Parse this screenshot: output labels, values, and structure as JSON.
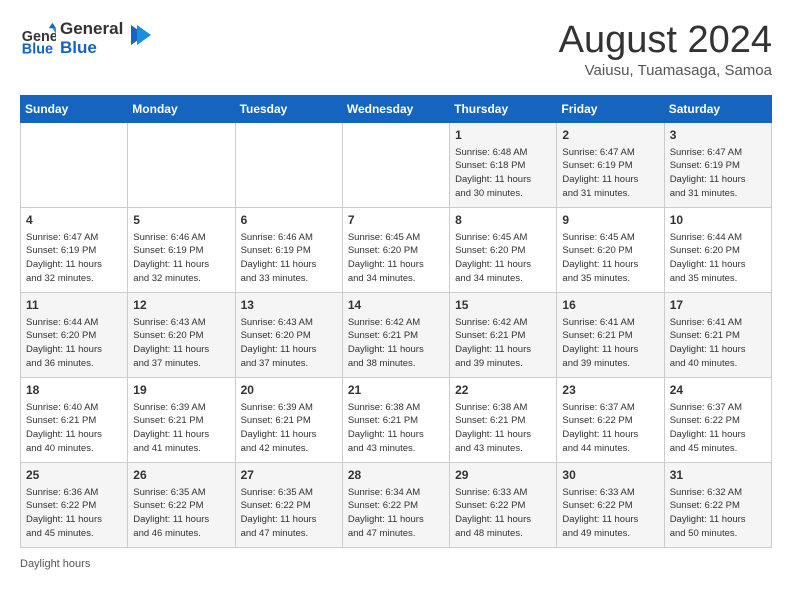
{
  "header": {
    "logo_line1": "General",
    "logo_line2": "Blue",
    "month_year": "August 2024",
    "location": "Vaiusu, Tuamasaga, Samoa"
  },
  "days_of_week": [
    "Sunday",
    "Monday",
    "Tuesday",
    "Wednesday",
    "Thursday",
    "Friday",
    "Saturday"
  ],
  "weeks": [
    [
      {
        "day": "",
        "info": ""
      },
      {
        "day": "",
        "info": ""
      },
      {
        "day": "",
        "info": ""
      },
      {
        "day": "",
        "info": ""
      },
      {
        "day": "1",
        "info": "Sunrise: 6:48 AM\nSunset: 6:18 PM\nDaylight: 11 hours\nand 30 minutes."
      },
      {
        "day": "2",
        "info": "Sunrise: 6:47 AM\nSunset: 6:19 PM\nDaylight: 11 hours\nand 31 minutes."
      },
      {
        "day": "3",
        "info": "Sunrise: 6:47 AM\nSunset: 6:19 PM\nDaylight: 11 hours\nand 31 minutes."
      }
    ],
    [
      {
        "day": "4",
        "info": "Sunrise: 6:47 AM\nSunset: 6:19 PM\nDaylight: 11 hours\nand 32 minutes."
      },
      {
        "day": "5",
        "info": "Sunrise: 6:46 AM\nSunset: 6:19 PM\nDaylight: 11 hours\nand 32 minutes."
      },
      {
        "day": "6",
        "info": "Sunrise: 6:46 AM\nSunset: 6:19 PM\nDaylight: 11 hours\nand 33 minutes."
      },
      {
        "day": "7",
        "info": "Sunrise: 6:45 AM\nSunset: 6:20 PM\nDaylight: 11 hours\nand 34 minutes."
      },
      {
        "day": "8",
        "info": "Sunrise: 6:45 AM\nSunset: 6:20 PM\nDaylight: 11 hours\nand 34 minutes."
      },
      {
        "day": "9",
        "info": "Sunrise: 6:45 AM\nSunset: 6:20 PM\nDaylight: 11 hours\nand 35 minutes."
      },
      {
        "day": "10",
        "info": "Sunrise: 6:44 AM\nSunset: 6:20 PM\nDaylight: 11 hours\nand 35 minutes."
      }
    ],
    [
      {
        "day": "11",
        "info": "Sunrise: 6:44 AM\nSunset: 6:20 PM\nDaylight: 11 hours\nand 36 minutes."
      },
      {
        "day": "12",
        "info": "Sunrise: 6:43 AM\nSunset: 6:20 PM\nDaylight: 11 hours\nand 37 minutes."
      },
      {
        "day": "13",
        "info": "Sunrise: 6:43 AM\nSunset: 6:20 PM\nDaylight: 11 hours\nand 37 minutes."
      },
      {
        "day": "14",
        "info": "Sunrise: 6:42 AM\nSunset: 6:21 PM\nDaylight: 11 hours\nand 38 minutes."
      },
      {
        "day": "15",
        "info": "Sunrise: 6:42 AM\nSunset: 6:21 PM\nDaylight: 11 hours\nand 39 minutes."
      },
      {
        "day": "16",
        "info": "Sunrise: 6:41 AM\nSunset: 6:21 PM\nDaylight: 11 hours\nand 39 minutes."
      },
      {
        "day": "17",
        "info": "Sunrise: 6:41 AM\nSunset: 6:21 PM\nDaylight: 11 hours\nand 40 minutes."
      }
    ],
    [
      {
        "day": "18",
        "info": "Sunrise: 6:40 AM\nSunset: 6:21 PM\nDaylight: 11 hours\nand 40 minutes."
      },
      {
        "day": "19",
        "info": "Sunrise: 6:39 AM\nSunset: 6:21 PM\nDaylight: 11 hours\nand 41 minutes."
      },
      {
        "day": "20",
        "info": "Sunrise: 6:39 AM\nSunset: 6:21 PM\nDaylight: 11 hours\nand 42 minutes."
      },
      {
        "day": "21",
        "info": "Sunrise: 6:38 AM\nSunset: 6:21 PM\nDaylight: 11 hours\nand 43 minutes."
      },
      {
        "day": "22",
        "info": "Sunrise: 6:38 AM\nSunset: 6:21 PM\nDaylight: 11 hours\nand 43 minutes."
      },
      {
        "day": "23",
        "info": "Sunrise: 6:37 AM\nSunset: 6:22 PM\nDaylight: 11 hours\nand 44 minutes."
      },
      {
        "day": "24",
        "info": "Sunrise: 6:37 AM\nSunset: 6:22 PM\nDaylight: 11 hours\nand 45 minutes."
      }
    ],
    [
      {
        "day": "25",
        "info": "Sunrise: 6:36 AM\nSunset: 6:22 PM\nDaylight: 11 hours\nand 45 minutes."
      },
      {
        "day": "26",
        "info": "Sunrise: 6:35 AM\nSunset: 6:22 PM\nDaylight: 11 hours\nand 46 minutes."
      },
      {
        "day": "27",
        "info": "Sunrise: 6:35 AM\nSunset: 6:22 PM\nDaylight: 11 hours\nand 47 minutes."
      },
      {
        "day": "28",
        "info": "Sunrise: 6:34 AM\nSunset: 6:22 PM\nDaylight: 11 hours\nand 47 minutes."
      },
      {
        "day": "29",
        "info": "Sunrise: 6:33 AM\nSunset: 6:22 PM\nDaylight: 11 hours\nand 48 minutes."
      },
      {
        "day": "30",
        "info": "Sunrise: 6:33 AM\nSunset: 6:22 PM\nDaylight: 11 hours\nand 49 minutes."
      },
      {
        "day": "31",
        "info": "Sunrise: 6:32 AM\nSunset: 6:22 PM\nDaylight: 11 hours\nand 50 minutes."
      }
    ]
  ],
  "footer": {
    "daylight_label": "Daylight hours"
  }
}
